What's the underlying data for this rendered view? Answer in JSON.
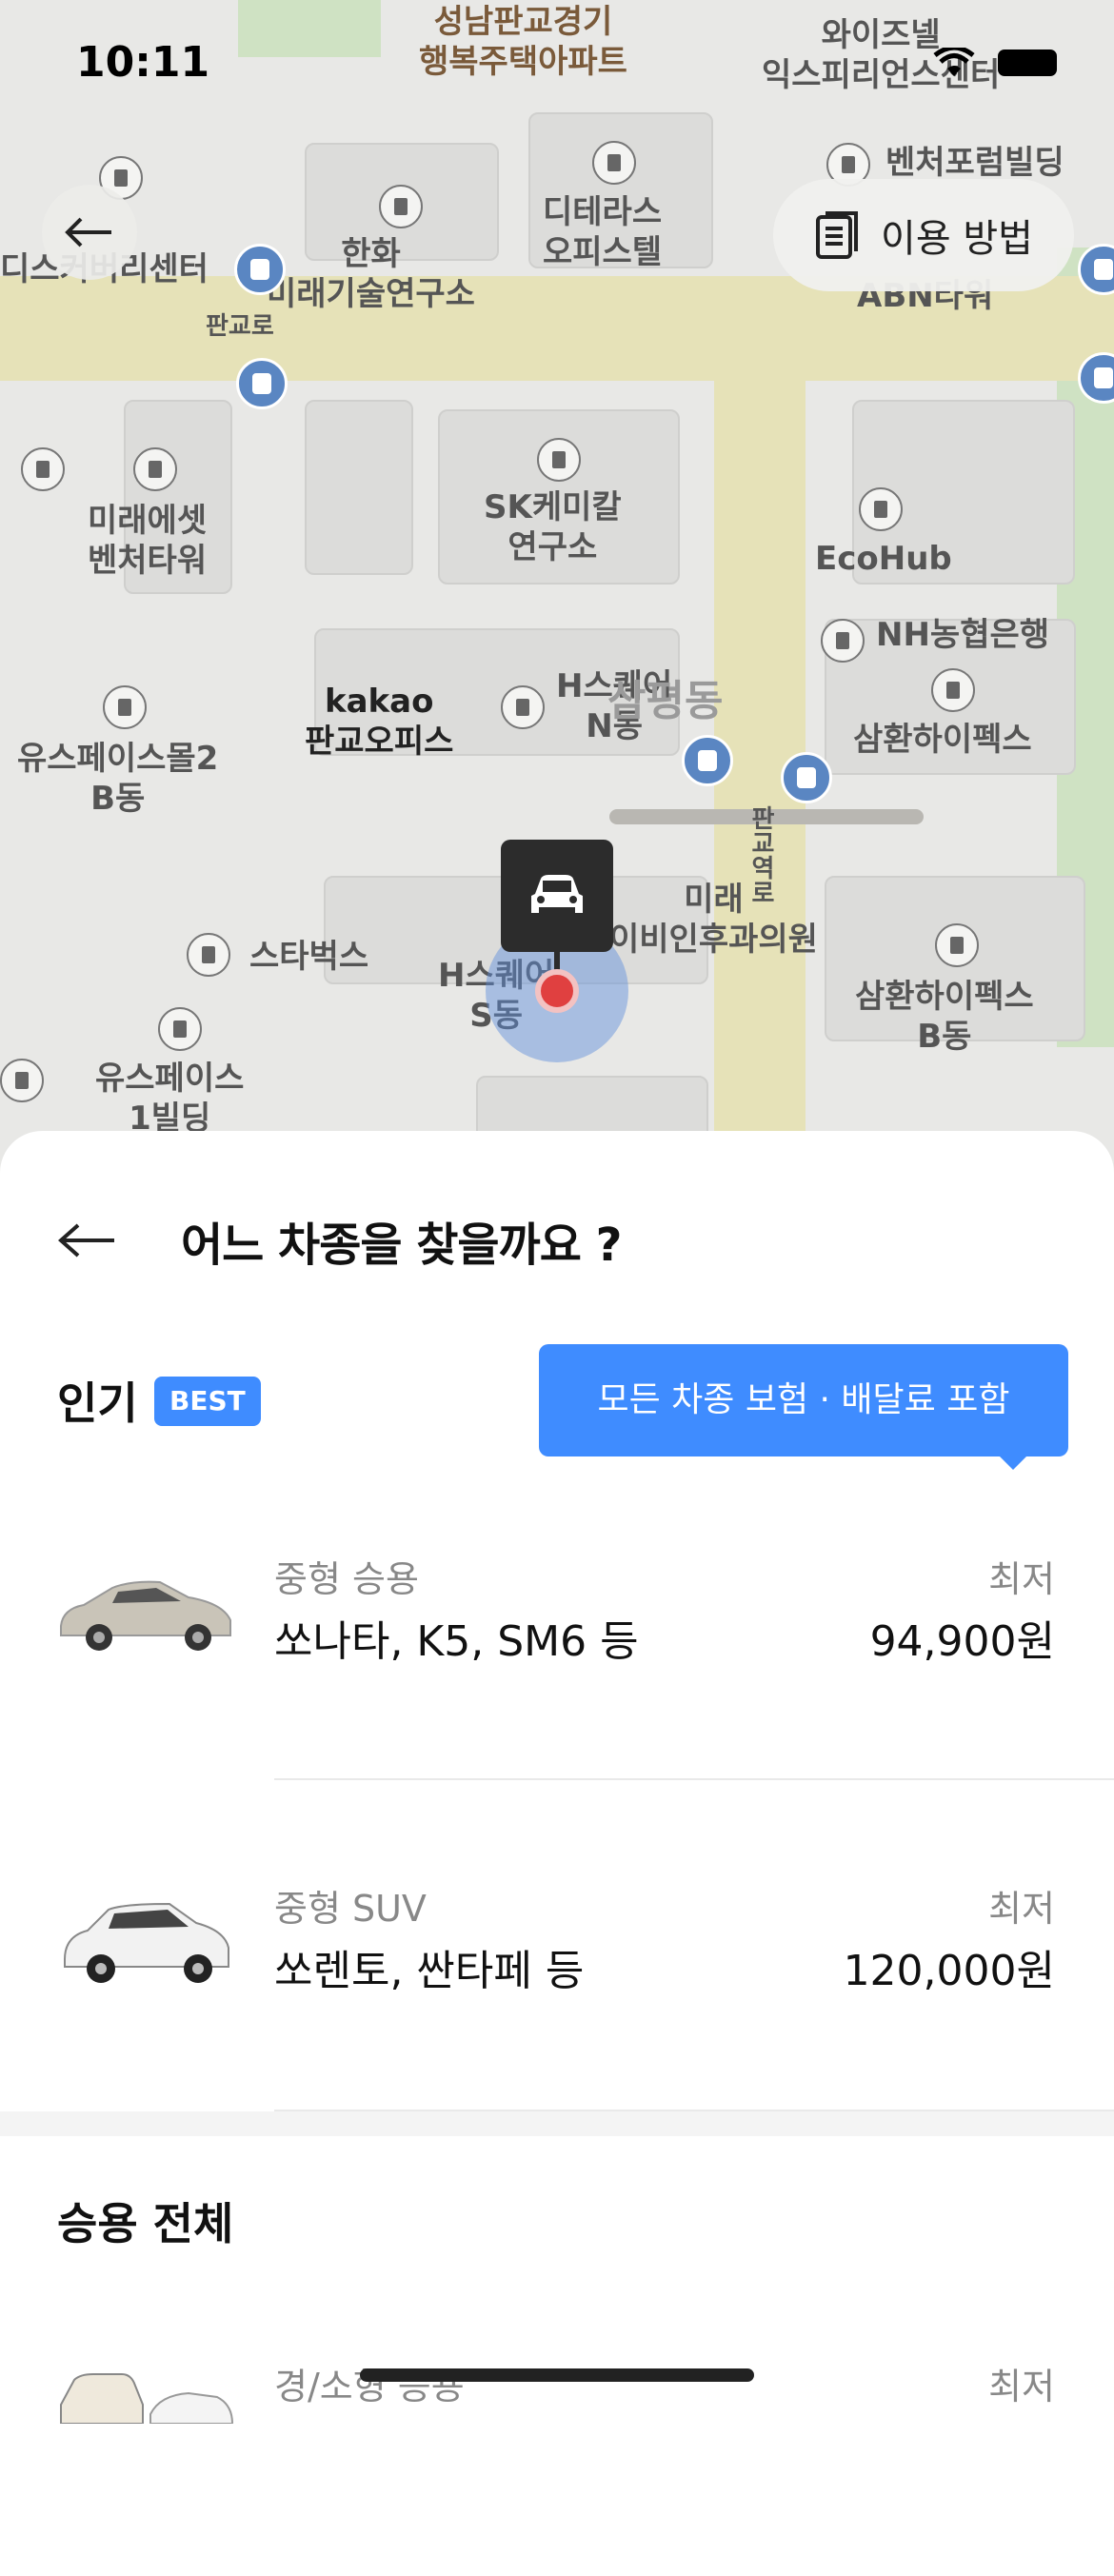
{
  "status_bar": {
    "time": "10:11"
  },
  "map": {
    "guide_button_label": "이용 방법",
    "labels": [
      "성남판교경기\n행복주택아파트",
      "와이즈넬\n익스피리언스센터",
      "벤처포럼빌딩",
      "디스커버리센터",
      "한화\n미래기술연구소",
      "디테라스\n오피스텔",
      "ABN타워",
      "판교로",
      "미래에셋\n벤처타워",
      "SK케미칼\n연구소",
      "EcoHub",
      "NH농협은행",
      "삼환하이펙스",
      "kakao\n판교오피스",
      "H스퀘어\nN동",
      "삼평동",
      "유스페이스몰2\nB동",
      "미래\n이비인후과의원",
      "스타벅스",
      "H스퀘어\nS동",
      "삼환하이펙스\nB동",
      "유스페이스\n1빌딩",
      "판교역로"
    ]
  },
  "sheet": {
    "title": "어느 차종을 찾을까요 ?",
    "popular": {
      "title": "인기",
      "badge": "BEST",
      "tooltip": "모든 차종 보험 · 배달료 포함",
      "items": [
        {
          "category": "중형 승용",
          "models": "쏘나타, K5, SM6 등",
          "low_label": "최저",
          "price": "94,900원",
          "color": "#c9c4b8"
        },
        {
          "category": "중형 SUV",
          "models": "쏘렌토, 싼타페 등",
          "low_label": "최저",
          "price": "120,000원",
          "color": "#f2f2f2"
        }
      ]
    },
    "all": {
      "title": "승용 전체",
      "items": [
        {
          "category": "경/소형 승용",
          "low_label": "최저"
        }
      ]
    }
  }
}
